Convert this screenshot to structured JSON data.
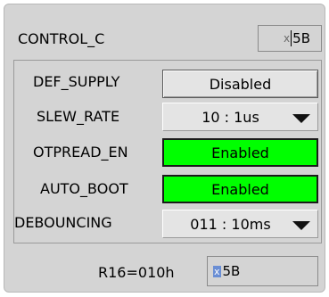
{
  "panel": {
    "title": "CONTROL_C",
    "hex": {
      "prefix": "x",
      "value": "5B"
    }
  },
  "fields": [
    {
      "label": "DEF_SUPPLY",
      "value": "Disabled"
    },
    {
      "label": "SLEW_RATE",
      "value": "10 : 1us"
    },
    {
      "label": "OTPREAD_EN",
      "value": "Enabled"
    },
    {
      "label": "AUTO_BOOT",
      "value": "Enabled"
    },
    {
      "label": "DEBOUNCING",
      "value": "011 : 10ms"
    }
  ],
  "register": {
    "label": "R16=010h",
    "prefix": "x",
    "value": "5B"
  },
  "colors": {
    "enabled": "#00ff00",
    "panel": "#d4d4d4"
  }
}
